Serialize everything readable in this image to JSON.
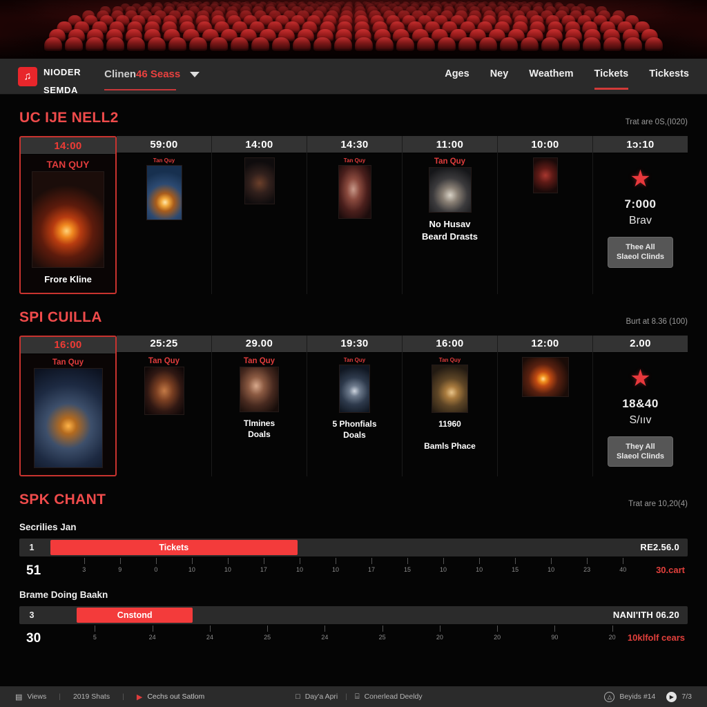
{
  "navbar": {
    "brand": {
      "line1": "NIODER",
      "line2": "SEMDA",
      "logo_icon": "film-reel-icon",
      "logo_glyph": "♫"
    },
    "selector": {
      "part1": "Clinen",
      "part2": "46",
      "part3": " Seass",
      "caret_icon": "chevron-down-icon"
    },
    "links": [
      {
        "label": "Ages",
        "active": false
      },
      {
        "label": "Ney",
        "active": false
      },
      {
        "label": "Weathem",
        "active": false
      },
      {
        "label": "Tickets",
        "active": true
      },
      {
        "label": "Tickests",
        "active": false
      }
    ]
  },
  "sections": [
    {
      "title": "UC IJE NELL2",
      "meta": "Trat are 0S,(I020)",
      "columns": [
        {
          "time": "14:00",
          "featured": true,
          "sub": "TAN QUY",
          "sub_small": "▬▬▬▬▬",
          "poster": "inferno",
          "poster_w": 105,
          "poster_h": 140,
          "caption": "Frore Kline"
        },
        {
          "time": "59:00",
          "featured": false,
          "sub": "Tan Quy",
          "poster": "bluefire",
          "poster_w": 52,
          "poster_h": 80,
          "caption": ""
        },
        {
          "time": "14:00",
          "featured": false,
          "sub": "",
          "poster": "darkteam",
          "poster_w": 44,
          "poster_h": 68,
          "caption": ""
        },
        {
          "time": "14:30",
          "featured": false,
          "sub": "Tan Quy",
          "poster": "woman",
          "poster_w": 48,
          "poster_h": 78,
          "caption": ""
        },
        {
          "time": "11:00",
          "featured": false,
          "sub": "Tan Quy",
          "poster": "snowman",
          "poster_w": 62,
          "poster_h": 66,
          "caption": "No Husav\nBeard Drasts"
        },
        {
          "time": "10:00",
          "featured": false,
          "sub": "",
          "poster": "crimson",
          "poster_w": 36,
          "poster_h": 52,
          "caption": ""
        },
        {
          "time": "1ɔ:10",
          "featured": false,
          "summary": {
            "star_icon": "star-icon",
            "value": "7:000",
            "label": "Brav",
            "button": "Thee All\nSlaeol Clinds"
          }
        }
      ]
    },
    {
      "title": "SPI CUILLA",
      "meta": "Burt at 8.36 (100)",
      "columns": [
        {
          "time": "16:00",
          "featured": true,
          "sub": "Tan Quy",
          "poster": "squad",
          "poster_w": 100,
          "poster_h": 145,
          "caption": ""
        },
        {
          "time": "25:25",
          "featured": false,
          "sub": "Tan Quy",
          "poster": "warrior",
          "poster_w": 58,
          "poster_h": 70,
          "caption": ""
        },
        {
          "time": "29.00",
          "featured": false,
          "sub": "Tan Quy",
          "poster": "lady",
          "poster_w": 57,
          "poster_h": 66,
          "caption": "Tlmines\nDoals"
        },
        {
          "time": "19:30",
          "featured": false,
          "sub": "Tan Quy",
          "poster": "storm",
          "poster_w": 45,
          "poster_h": 70,
          "caption": "5 Phonfials\nDoals"
        },
        {
          "time": "16:00",
          "featured": false,
          "sub": "Tan Quy",
          "poster": "village",
          "poster_w": 53,
          "poster_h": 70,
          "caption": "11960\n\nBamls Phace"
        },
        {
          "time": "12:00",
          "featured": false,
          "sub": "",
          "poster": "blaze",
          "poster_w": 68,
          "poster_h": 58,
          "caption": ""
        },
        {
          "time": "2.00",
          "featured": false,
          "summary": {
            "star_icon": "star-icon",
            "value": "18&40",
            "label": "S/ııv",
            "button": "They All\nSlaeol Clinds"
          }
        }
      ]
    }
  ],
  "chart_section": {
    "title": "SPK CHANT",
    "meta": "Trat are 10,20(4)"
  },
  "chart_data": {
    "type": "bar",
    "title": "SPK CHANT",
    "charts": [
      {
        "label": "Secrilies Jan",
        "index": "1",
        "bar_label": "Tickets",
        "bar_start_pct": 4.5,
        "bar_width_pct": 37,
        "end_label": "RE2.56.0",
        "axis_big": "51",
        "right_label": "30.cart",
        "ticks": [
          3,
          9,
          0,
          10,
          10,
          17,
          10,
          10,
          17,
          15,
          10,
          10,
          15,
          10,
          23,
          40
        ]
      },
      {
        "label": "Brame Doing Baakn",
        "index": "3",
        "bar_label": "Cnstond",
        "bar_start_pct": 8.5,
        "bar_width_pct": 17.3,
        "end_label": "NANI'ITH 06.20",
        "axis_big": "30",
        "right_label": "10klfolf cears",
        "ticks": [
          5,
          24,
          24,
          25,
          24,
          25,
          20,
          20,
          90,
          20
        ]
      }
    ],
    "ylabel": "",
    "xlabel": "",
    "grid": false,
    "legend": "none"
  },
  "footer": {
    "left": [
      {
        "icon": "screen-icon",
        "glyph": "▤",
        "label": "Views"
      },
      {
        "icon": "",
        "glyph": "",
        "label": "2019 Shats"
      },
      {
        "icon": "play-icon",
        "glyph": "▶",
        "label": "Cechs out Satlom",
        "red": true
      }
    ],
    "middle": [
      {
        "icon": "calendar-icon",
        "glyph": "□",
        "label": "Day'a Apri"
      },
      {
        "icon": "grid-icon",
        "glyph": "⌸",
        "label": "Conerlead Deeldy"
      }
    ],
    "right": [
      {
        "icon": "user-circle-icon",
        "glyph": "△",
        "label": "Beyids #14"
      },
      {
        "icon": "play-circle-icon",
        "glyph": "▶",
        "label": "7/3"
      }
    ]
  }
}
